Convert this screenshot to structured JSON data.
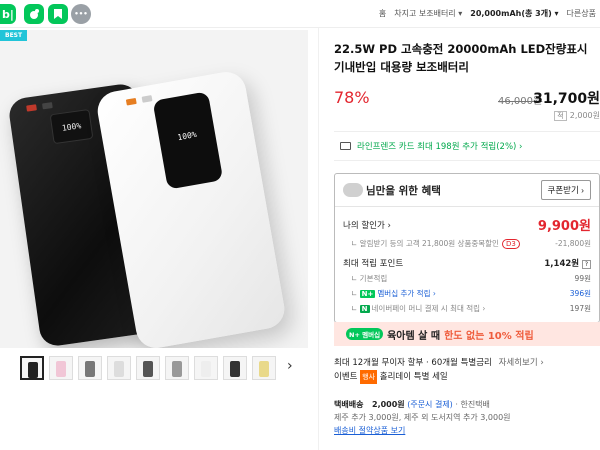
{
  "topbar": {
    "icons": [
      "blog-icon",
      "cafe-icon",
      "bookmark-icon",
      "more-icon"
    ],
    "blog_glyph": "b|",
    "more_glyph": "•••",
    "breadcrumb": {
      "home": "홈",
      "category": "차지고 보조배터리",
      "option": "20,000mAh(총 3개)",
      "more": "다른상품"
    }
  },
  "gallery": {
    "best_badge": "BEST",
    "screen_black": "100%",
    "screen_white": "100%",
    "thumb_count": 11,
    "next_glyph": "›"
  },
  "product": {
    "title": "22.5W PD 고속충전 20000mAh LED잔량표시 기내반입 대용량 보조배터리",
    "discount": "78%",
    "original_price": "46,000원",
    "final_price": "31,700원",
    "save_tag": "적",
    "save_amount": "2,000원",
    "card_benefit": "라인프렌즈 카드 최대 198원 추가 적립(2%) ›"
  },
  "coupon": {
    "header": "님만을 위한 혜택",
    "button": "쿠폰받기 ›",
    "my_price_label": "나의 할인가 ›",
    "my_price_value": "9,900원",
    "alert_text": "알림받기 등의 고객 21,800원 상품중복할인",
    "alert_badge": "D3",
    "alert_value": "-21,800원",
    "points_label": "최대 적립 포인트",
    "points_value": "1,142원",
    "points_info": "?",
    "basic_label": "기본적립",
    "basic_value": "99원",
    "membership_label": "멤버십 추가 적립 ›",
    "membership_value": "396원",
    "npay_label": "네이버페이 머니 결제 시 최대 적립 ›",
    "npay_value": "197원"
  },
  "promo": {
    "pill": "N+ 멤버십",
    "text_a": "육아템 살 때",
    "text_b": "한도 없는 10% 적립"
  },
  "info": {
    "installment": "최대 12개월 무이자 할부 · 60개월 특별금리",
    "installment_link": "자세히보기 ›",
    "event_label": "이벤트",
    "event_badge": "행사",
    "event_text": "홀리데이 특별 세일"
  },
  "shipping": {
    "label": "택배배송",
    "fee": "2,000원",
    "fee_note": "(주문시 결제)",
    "carrier": "한진택배",
    "extra": "제주 추가 3,000원, 제주 외 도서지역 추가 3,000원",
    "link": "배송비 절약상품 보기"
  },
  "colors": {
    "accent_green": "#03c75a",
    "sale_red": "#e3262f",
    "link_blue": "#1a5fd6",
    "promo_bg": "#ffe6e1"
  }
}
